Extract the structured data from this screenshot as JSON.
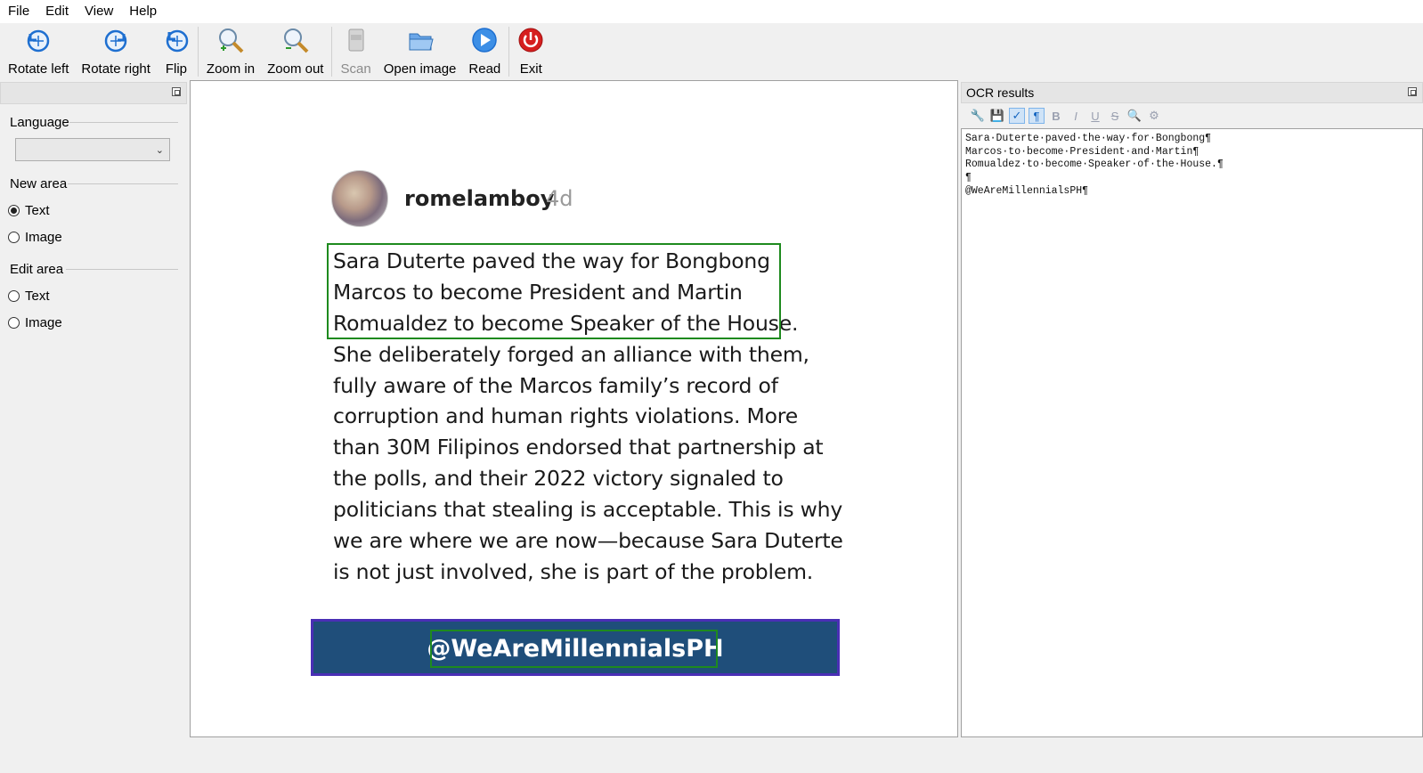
{
  "menu": [
    "File",
    "Edit",
    "View",
    "Help"
  ],
  "toolbar": {
    "rotate_left": "Rotate left",
    "rotate_right": "Rotate right",
    "flip": "Flip",
    "zoom_in": "Zoom in",
    "zoom_out": "Zoom out",
    "scan": "Scan",
    "open_image": "Open image",
    "read": "Read",
    "exit": "Exit"
  },
  "left_panel": {
    "language_label": "Language",
    "language_value": "",
    "new_area_label": "New area",
    "new_area_text": "Text",
    "new_area_image": "Image",
    "edit_area_label": "Edit area",
    "edit_area_text": "Text",
    "edit_area_image": "Image"
  },
  "post": {
    "username": "romelamboy",
    "age": "4d",
    "lines": [
      "Sara Duterte paved the way for Bongbong",
      "Marcos to become President and Martin",
      "Romualdez to become Speaker of the House.",
      "She deliberately forged an alliance with them,",
      "fully aware of the Marcos family’s record of",
      "corruption and human rights violations. More",
      "than 30M Filipinos endorsed that partnership at",
      "the polls, and their 2022 victory signaled to",
      "politicians that stealing is acceptable. This is why",
      "we are where we are now—because Sara Duterte",
      "is not just involved, she is part of the problem."
    ],
    "banner": "@WeAreMillennialsPH"
  },
  "ocr": {
    "title": "OCR results",
    "lines": [
      "Sara·Duterte·paved·the·way·for·Bongbong¶",
      "Marcos·to·become·President·and·Martin¶",
      "Romualdez·to·become·Speaker·of·the·House.¶",
      "¶",
      "@WeAreMillennialsPH¶"
    ]
  },
  "colors": {
    "selection": "#1e8a1e",
    "banner_bg": "#1f4e7a",
    "banner_border": "#4a2fb5",
    "tool_blue": "#1e6fd0",
    "exit_red": "#d61f1f"
  }
}
